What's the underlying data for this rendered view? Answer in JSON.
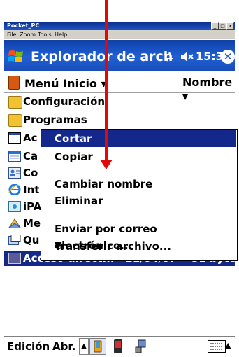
{
  "window": {
    "title": "Pocket_PC",
    "menu": [
      "File",
      "Zoom",
      "Tools",
      "Help"
    ],
    "controls": [
      "_",
      "□",
      "x"
    ]
  },
  "title_bar": {
    "app_title": "Explorador de arch",
    "clock": "15:33",
    "close_label": "✕"
  },
  "toolbar": {
    "folder_label": "Menú Inicio",
    "sort_label": "Nombre"
  },
  "files": [
    {
      "name": "Configuración",
      "icon": "folder-icon"
    },
    {
      "name": "Programas",
      "icon": "folder-icon"
    },
    {
      "name": "Ac",
      "icon": "shortcut-icon"
    },
    {
      "name": "Ca",
      "icon": "calendar-icon"
    },
    {
      "name": "Co",
      "icon": "contacts-icon"
    },
    {
      "name": "Int",
      "icon": "internet-explorer-icon"
    },
    {
      "name": "iPA",
      "icon": "ipaq-icon"
    },
    {
      "name": "Me",
      "icon": "messaging-icon"
    },
    {
      "name": "Qu",
      "icon": "quick-icon"
    },
    {
      "name": "Acceso direct...   21/04/07    51 bytes",
      "icon": "shortcut-icon",
      "selected": true
    }
  ],
  "context_menu": {
    "items": [
      "Cortar",
      "Copiar",
      "Cambiar nombre",
      "Eliminar",
      "Enviar por correo electrónico...",
      "Transferir archivo..."
    ],
    "highlighted": "Cortar"
  },
  "menu_bar": {
    "edit": "Edición",
    "open": "Abr."
  },
  "colors": {
    "title_blue": "#1f60d4",
    "selection": "#14288c",
    "annotation_arrow": "#e30808"
  }
}
